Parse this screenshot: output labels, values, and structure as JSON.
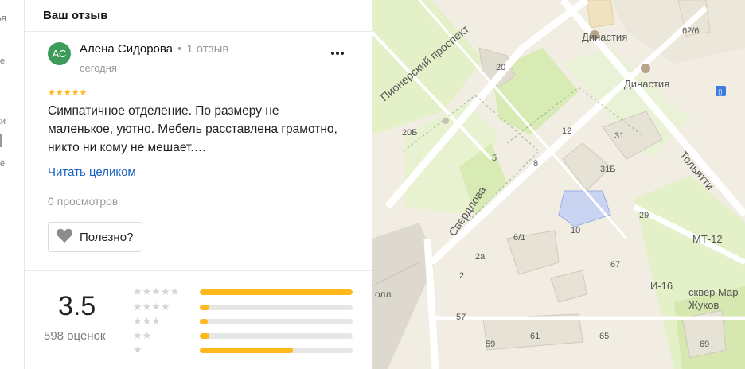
{
  "left_strip": {
    "labels": [
      "ья",
      "е",
      "ки",
      "ё"
    ]
  },
  "review_section": {
    "title": "Ваш отзыв",
    "author": {
      "initials": "АС",
      "name": "Алена Сидорова",
      "dot": "•",
      "review_count": "1 отзыв",
      "date": "сегодня"
    },
    "more_icon": "more-dots-icon",
    "rating_stars": "★★★★★",
    "text": "Симпатичное отделение. По размеру не маленькое, уютно. Мебель расставлена грамотно, никто ни кому не мешает.…",
    "read_more": "Читать целиком",
    "views": "0 просмотров",
    "useful_button": {
      "icon": "heart-icon",
      "label": "Полезно?"
    }
  },
  "rating_summary": {
    "score": "3.5",
    "count": "598 оценок",
    "distribution": [
      {
        "stars": "★★★★★",
        "value": 1.0
      },
      {
        "stars": "★★★★",
        "value": 0.06
      },
      {
        "stars": "★★★",
        "value": 0.05
      },
      {
        "stars": "★★",
        "value": 0.06
      },
      {
        "stars": "★",
        "value": 0.61
      }
    ]
  },
  "map": {
    "labels": {
      "pioner": "Пионерский проспект",
      "sverdlova": "Свердлова",
      "tolyatti": "Тольятти",
      "dinastiya1": "Династия",
      "dinastiya2": "Династия",
      "mt12": "МТ-12",
      "i16": "И-16",
      "skver1": "сквер Мар",
      "skver2": "Жуков",
      "oll": "олл",
      "n62": "62/6",
      "n20": "20",
      "n20b": "20Б",
      "n12": "12",
      "n31": "31",
      "n31b": "31Б",
      "n8": "8",
      "n5": "5",
      "n10": "10",
      "n61": "6/1",
      "n2a": "2а",
      "n2": "2",
      "n57": "57",
      "n59": "59",
      "n61b": "61",
      "n65": "65",
      "n67": "67",
      "n29": "29",
      "n69": "69"
    }
  }
}
